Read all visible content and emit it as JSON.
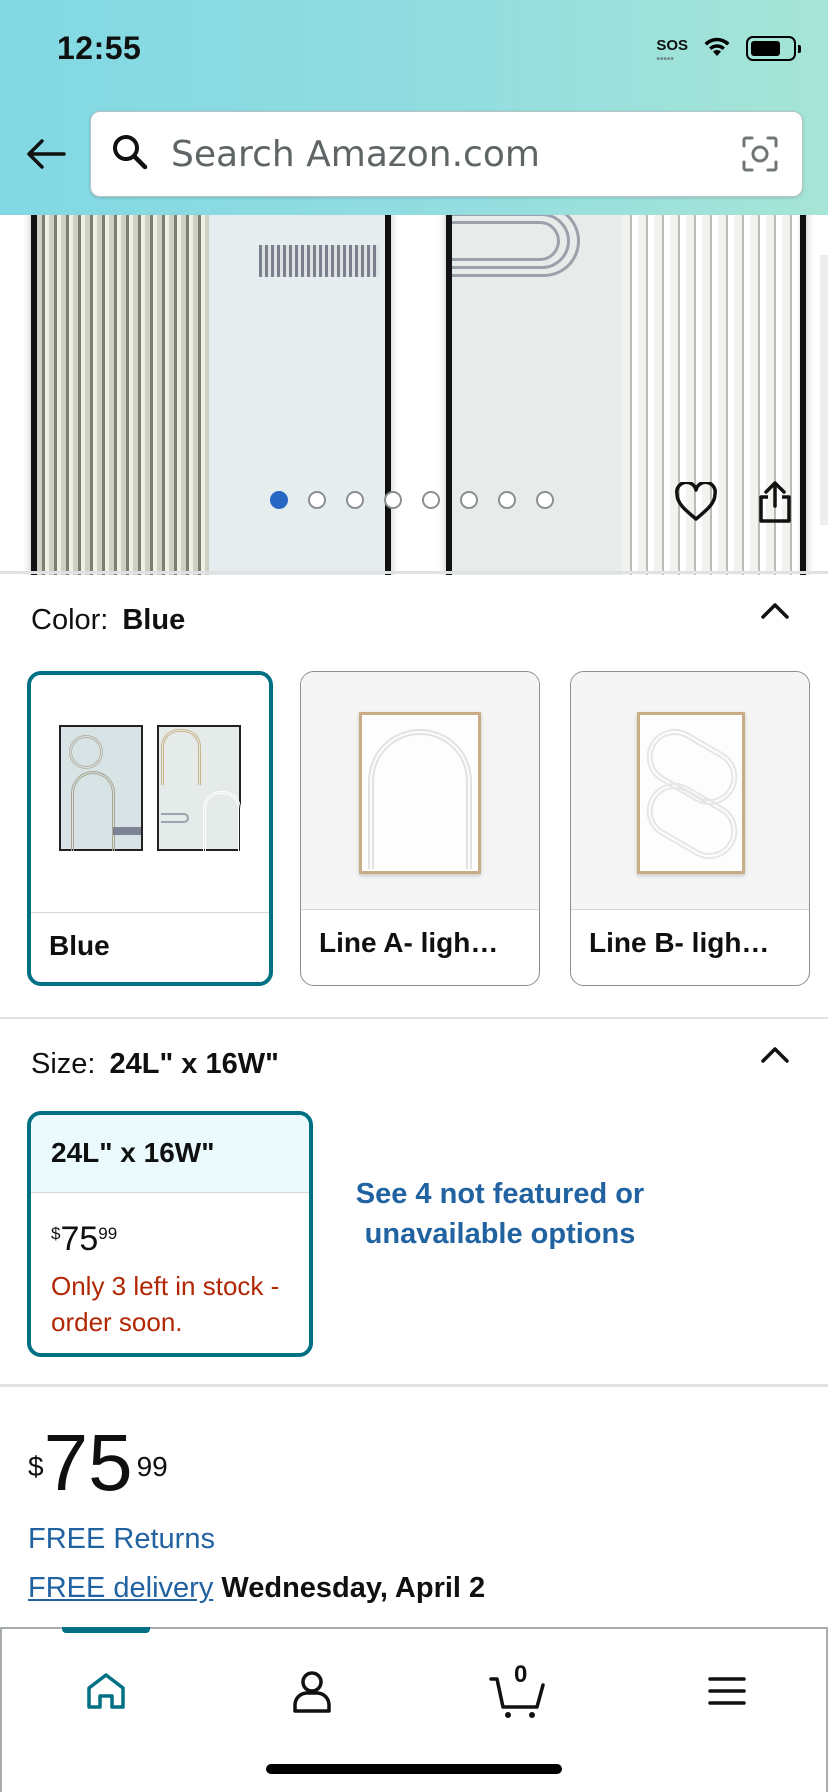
{
  "status_bar": {
    "time": "12:55",
    "sos": "SOS"
  },
  "search": {
    "placeholder": "Search Amazon.com"
  },
  "gallery": {
    "image_count": 8,
    "active_index": 0
  },
  "color": {
    "label": "Color:",
    "value": "Blue",
    "options": [
      {
        "label": "Blue",
        "selected": true
      },
      {
        "label": "Line A- ligh…",
        "selected": false
      },
      {
        "label": "Line B- ligh…",
        "selected": false
      }
    ]
  },
  "size": {
    "label": "Size:",
    "value": "24L\" x 16W\"",
    "option": {
      "label": "24L\" x 16W\"",
      "price_currency": "$",
      "price_whole": "75",
      "price_cents": "99",
      "stock": "Only 3 left in stock - order soon."
    },
    "see_more": "See 4 not featured or unavailable options"
  },
  "price": {
    "currency": "$",
    "whole": "75",
    "cents": "99"
  },
  "free_returns": "FREE Returns",
  "delivery": {
    "link": "FREE delivery",
    "date": "Wednesday, April 2"
  },
  "bottom_nav": {
    "cart_count": "0",
    "active": "home"
  },
  "colors": {
    "accent_teal": "#007185",
    "link_blue": "#2162a1",
    "stock_red": "#b12704",
    "dot_active": "#2668c3"
  }
}
